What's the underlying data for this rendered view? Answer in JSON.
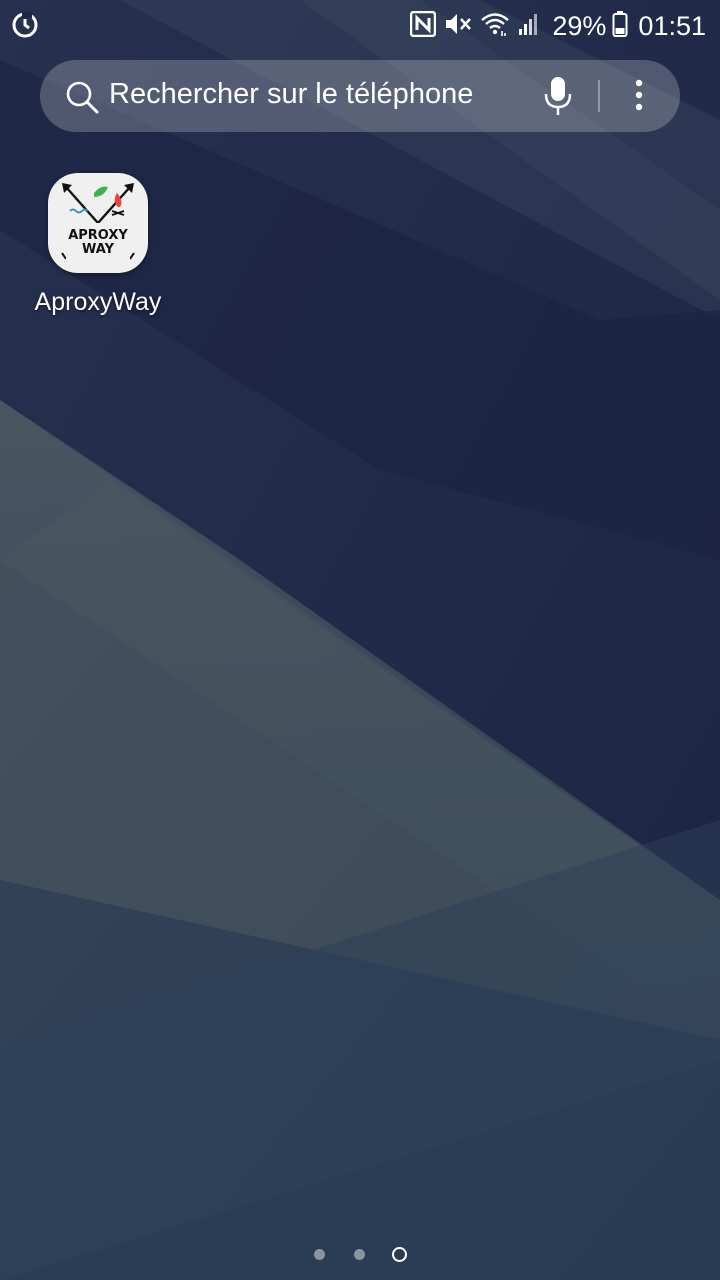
{
  "status_bar": {
    "battery_percent": "29%",
    "time": "01:51",
    "icons": [
      "sync-icon",
      "nfc-icon",
      "mute-icon",
      "wifi-icon",
      "signal-icon",
      "battery-icon"
    ]
  },
  "search": {
    "placeholder": "Rechercher sur le téléphone",
    "icons": [
      "search-icon",
      "mic-icon",
      "more-vertical-icon"
    ]
  },
  "apps": [
    {
      "label": "AproxyWay",
      "logo_text_line1": "APROXY",
      "logo_text_line2": "WAY"
    }
  ],
  "page_indicator": {
    "pages": 3,
    "current": 3
  },
  "colors": {
    "wallpaper_dark": "#1c2443",
    "wallpaper_mid": "#2c3e58",
    "wallpaper_light": "#4a5864",
    "accent_green": "#3cb44b",
    "accent_red": "#e8453c"
  }
}
